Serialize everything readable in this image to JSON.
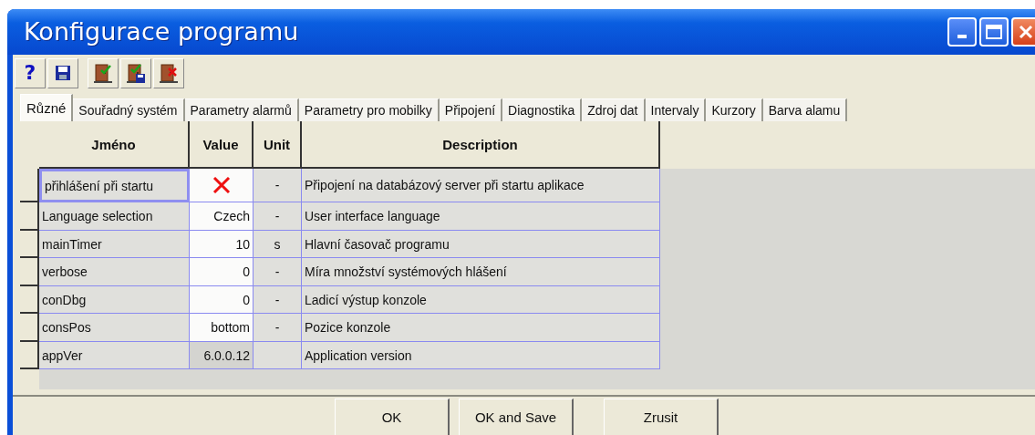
{
  "window": {
    "title": "Konfigurace programu"
  },
  "toolbar": [
    [
      {
        "kind": "help",
        "label": "?"
      },
      {
        "kind": "save"
      }
    ],
    [
      {
        "kind": "door-ok"
      },
      {
        "kind": "door-ok-save"
      },
      {
        "kind": "door-cancel"
      }
    ]
  ],
  "tabs": [
    {
      "label": "Různé",
      "selected": true
    },
    {
      "label": "Souřadný systém",
      "selected": false
    },
    {
      "label": "Parametry alarmů",
      "selected": false
    },
    {
      "label": "Parametry pro mobilky",
      "selected": false
    },
    {
      "label": "Připojení",
      "selected": false
    },
    {
      "label": "Diagnostika",
      "selected": false
    },
    {
      "label": "Zdroj dat",
      "selected": false
    },
    {
      "label": "Intervaly",
      "selected": false
    },
    {
      "label": "Kurzory",
      "selected": false
    },
    {
      "label": "Barva alamu",
      "selected": false
    }
  ],
  "table": {
    "columns": [
      "Jméno",
      "Value",
      "Unit",
      "Description"
    ],
    "rows": [
      {
        "name": "přihlášení při startu",
        "kind": "bool",
        "checked": false,
        "unit": "-",
        "description": "Připojení na databázový server při startu aplikace",
        "selected": true,
        "readonly": false
      },
      {
        "name": "Language selection",
        "kind": "text",
        "value": "Czech",
        "unit": "-",
        "description": "User interface language",
        "selected": false,
        "readonly": false
      },
      {
        "name": "mainTimer",
        "kind": "text",
        "value": "10",
        "unit": "s",
        "description": "Hlavní časovač programu",
        "selected": false,
        "readonly": false
      },
      {
        "name": "verbose",
        "kind": "text",
        "value": "0",
        "unit": "-",
        "description": "Míra množství systémových hlášení",
        "selected": false,
        "readonly": false
      },
      {
        "name": "conDbg",
        "kind": "text",
        "value": "0",
        "unit": "-",
        "description": "Ladicí výstup konzole",
        "selected": false,
        "readonly": false
      },
      {
        "name": "consPos",
        "kind": "text",
        "value": "bottom",
        "unit": "-",
        "description": "Pozice konzole",
        "selected": false,
        "readonly": false
      },
      {
        "name": "appVer",
        "kind": "text",
        "value": "6.0.0.12",
        "description": "Application version",
        "selected": false,
        "readonly": true
      }
    ]
  },
  "buttons": [
    "OK",
    "OK and Save",
    "Zrusit"
  ]
}
